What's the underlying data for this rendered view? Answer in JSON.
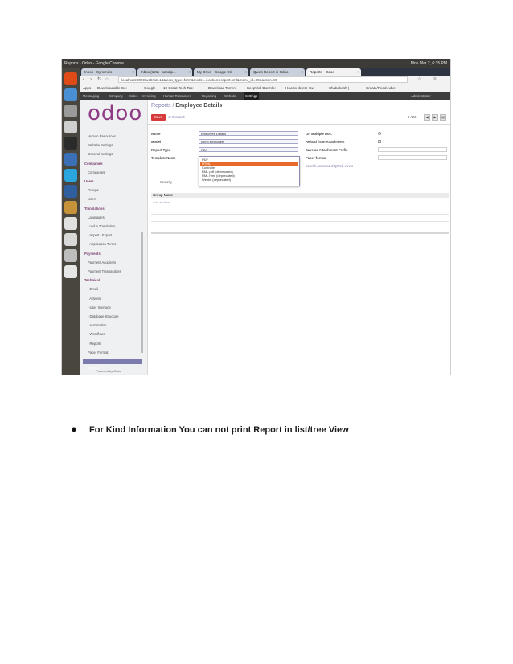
{
  "window": {
    "title": "Reports - Odoo - Google Chrome",
    "status": "Mon Mar 2, 6:35 PM"
  },
  "browser": {
    "tabs": [
      "Inbox - Syncmics",
      "Inbox (121) - sandip...",
      "My Drive - Google Dri",
      "Qweb Report in Odoo",
      "Reports - Odoo"
    ],
    "url": "localhost:8069/web#id=14&view_type=form&model=ir.actions.report.xml&menu_id=89&action=80",
    "bookmarks": [
      "Apps",
      "Downloadable Co:",
      "Google",
      "10 Great Tech Tas:",
      "Download Torrent",
      "KeepVid: Downlo:",
      "How to delete row",
      "Shabdkosh |",
      "Create/Read Adve"
    ]
  },
  "odoo": {
    "top_menu": [
      "Messaging",
      "Company",
      "Sales",
      "Invoicing",
      "Human Resources",
      "Reporting",
      "Website",
      "Settings"
    ],
    "active_menu": "Settings",
    "admin": "Administrator",
    "logo": "odoo",
    "sidebar": {
      "items": [
        {
          "label": "Human Resources",
          "type": "item"
        },
        {
          "label": "Website Settings",
          "type": "item"
        },
        {
          "label": "General Settings",
          "type": "item"
        },
        {
          "label": "Companies",
          "type": "head"
        },
        {
          "label": "Companies",
          "type": "item"
        },
        {
          "label": "Users",
          "type": "head"
        },
        {
          "label": "Groups",
          "type": "item"
        },
        {
          "label": "Users",
          "type": "item"
        },
        {
          "label": "Translations",
          "type": "head"
        },
        {
          "label": "Languages",
          "type": "item"
        },
        {
          "label": "Load a Translation",
          "type": "item"
        },
        {
          "label": "› Import / Export",
          "type": "item"
        },
        {
          "label": "› Application Terms",
          "type": "item"
        },
        {
          "label": "Payments",
          "type": "head"
        },
        {
          "label": "Payment Acquirers",
          "type": "item"
        },
        {
          "label": "Payment Transactions",
          "type": "item"
        },
        {
          "label": "Technical",
          "type": "head"
        },
        {
          "label": "› Email",
          "type": "item"
        },
        {
          "label": "› Actions",
          "type": "item"
        },
        {
          "label": "› User Interface",
          "type": "item"
        },
        {
          "label": "› Database Structure",
          "type": "item"
        },
        {
          "label": "› Automation",
          "type": "item"
        },
        {
          "label": "› Workflows",
          "type": "item"
        },
        {
          "label": "› Reports",
          "type": "item"
        },
        {
          "label": "Paper Format",
          "type": "item"
        },
        {
          "label": "Reports",
          "type": "selected"
        }
      ],
      "powered_by": "Powered by Odoo"
    },
    "breadcrumb": {
      "parent": "Reports",
      "current": "Employee Details"
    },
    "save_label": "Save",
    "discard_label": "or Discard",
    "pager": "6 / 26",
    "form": {
      "name_label": "Name",
      "name_value": "Employee Details",
      "model_label": "Model",
      "model_value": "comp.employee",
      "report_type_label": "Report Type",
      "report_type_value": "PDF",
      "template_label": "Template Name",
      "on_multiple_label": "On Multiple Doc.",
      "reload_label": "Reload from Attachment",
      "save_prefix_label": "Save as Attachment Prefix",
      "paper_format_label": "Paper format",
      "qweb_link": "Search associated QWeb views",
      "tab_security": "Security",
      "group_name_header": "Group Name",
      "add_item": "Add an item"
    },
    "report_type_options": [
      "PDF",
      "HTML",
      "Controller",
      "RML pdf (deprecated)",
      "RML html (deprecated)",
      "Webkit (deprecated)"
    ],
    "highlighted_option": "HTML"
  },
  "caption": {
    "bullet": "●",
    "text": "For Kind Information You can not print Report in list/tree View"
  }
}
